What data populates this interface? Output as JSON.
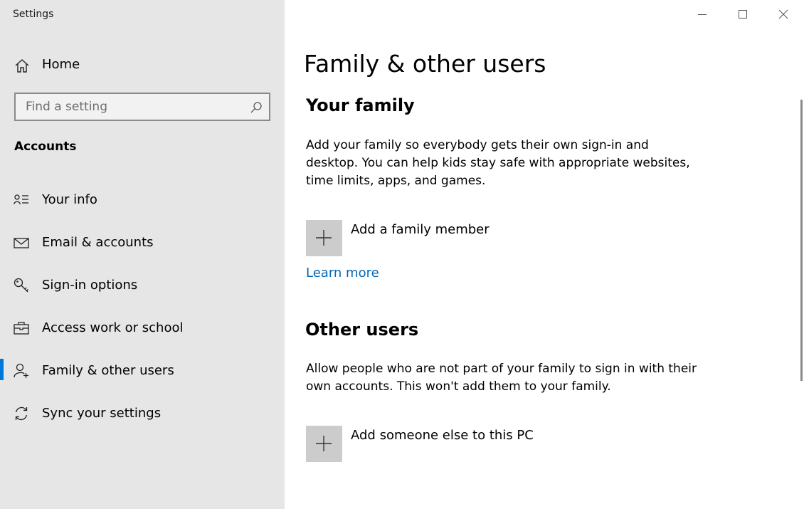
{
  "window": {
    "title": "Settings",
    "controls": [
      "minimize-icon",
      "maximize-icon",
      "close-icon"
    ]
  },
  "sidebar": {
    "home_label": "Home",
    "home_icon": "home-icon",
    "search": {
      "placeholder": "Find a setting",
      "value": "",
      "icon": "search-icon"
    },
    "section_title": "Accounts",
    "items": [
      {
        "label": "Your info",
        "icon": "contact-card-icon",
        "selected": false
      },
      {
        "label": "Email & accounts",
        "icon": "envelope-icon",
        "selected": false
      },
      {
        "label": "Sign-in options",
        "icon": "key-icon",
        "selected": false
      },
      {
        "label": "Access work or school",
        "icon": "briefcase-icon",
        "selected": false
      },
      {
        "label": "Family & other users",
        "icon": "add-person-icon",
        "selected": true
      },
      {
        "label": "Sync your settings",
        "icon": "sync-icon",
        "selected": false
      }
    ],
    "accent_color": "#0078d7"
  },
  "main": {
    "page_title": "Family & other users",
    "family": {
      "heading": "Your family",
      "description": "Add your family so everybody gets their own sign-in and desktop. You can help kids stay safe with appropriate websites, time limits, apps, and games.",
      "add_label": "Add a family member",
      "add_icon": "plus-icon",
      "learn_more": "Learn more"
    },
    "other_users": {
      "heading": "Other users",
      "description": "Allow people who are not part of your family to sign in with their own accounts. This won't add them to your family.",
      "add_label": "Add someone else to this PC",
      "add_icon": "plus-icon"
    },
    "link_color": "#0067b8"
  }
}
